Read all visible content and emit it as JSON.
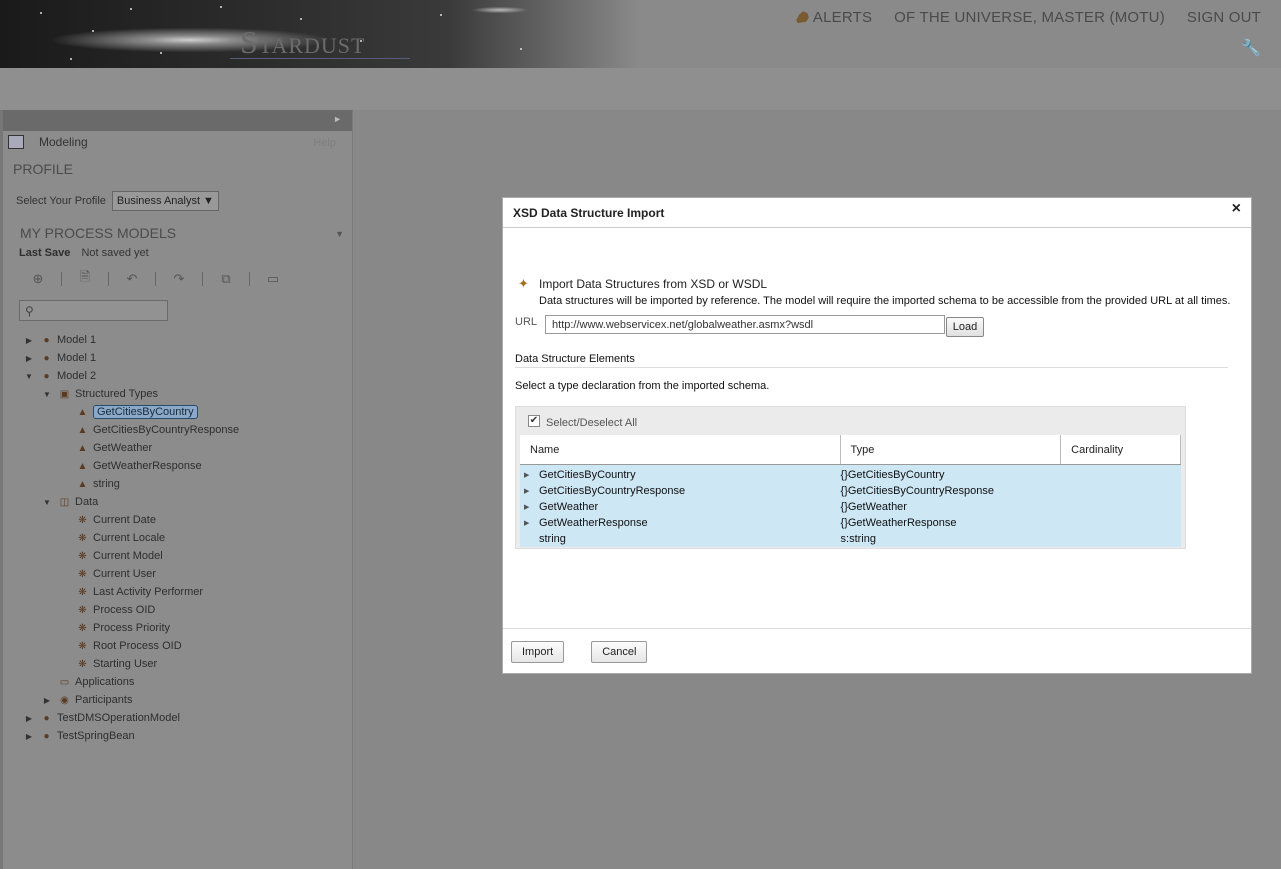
{
  "header": {
    "brand": "Stardust",
    "nav": {
      "alerts": "ALERTS",
      "user": "OF THE UNIVERSE, MASTER (MOTU)",
      "signout": "SIGN OUT"
    },
    "icons": [
      "bell-icon",
      "wrench-icon"
    ]
  },
  "panel": {
    "perspective": "Modeling",
    "help": "Help",
    "profile_heading": "PROFILE",
    "profile_label": "Select Your Profile",
    "profile_value": "Business Analyst",
    "models_heading": "MY PROCESS MODELS",
    "last_save_label": "Last Save",
    "last_save_value": "Not saved yet",
    "search_placeholder": "",
    "tree": [
      {
        "label": "Model 1",
        "level": 0,
        "expander": "collapsed",
        "icon": "model-icon"
      },
      {
        "label": "Model 1",
        "level": 0,
        "expander": "collapsed",
        "icon": "model-icon"
      },
      {
        "label": "Model 2",
        "level": 0,
        "expander": "expanded",
        "icon": "model-icon"
      },
      {
        "label": "Structured Types",
        "level": 1,
        "expander": "expanded",
        "icon": "structured-types-icon"
      },
      {
        "label": "GetCitiesByCountry",
        "level": 2,
        "icon": "type-icon",
        "selected": true
      },
      {
        "label": "GetCitiesByCountryResponse",
        "level": 2,
        "icon": "type-icon"
      },
      {
        "label": "GetWeather",
        "level": 2,
        "icon": "type-icon"
      },
      {
        "label": "GetWeatherResponse",
        "level": 2,
        "icon": "type-icon"
      },
      {
        "label": "string",
        "level": 2,
        "icon": "type-icon"
      },
      {
        "label": "Data",
        "level": 1,
        "expander": "expanded",
        "icon": "database-icon"
      },
      {
        "label": "Current Date",
        "level": 2,
        "icon": "data-icon"
      },
      {
        "label": "Current Locale",
        "level": 2,
        "icon": "data-icon"
      },
      {
        "label": "Current Model",
        "level": 2,
        "icon": "data-icon"
      },
      {
        "label": "Current User",
        "level": 2,
        "icon": "data-icon"
      },
      {
        "label": "Last Activity Performer",
        "level": 2,
        "icon": "data-icon"
      },
      {
        "label": "Process OID",
        "level": 2,
        "icon": "data-icon"
      },
      {
        "label": "Process Priority",
        "level": 2,
        "icon": "data-icon"
      },
      {
        "label": "Root Process OID",
        "level": 2,
        "icon": "data-icon"
      },
      {
        "label": "Starting User",
        "level": 2,
        "icon": "data-icon"
      },
      {
        "label": "Applications",
        "level": 1,
        "icon": "applications-icon"
      },
      {
        "label": "Participants",
        "level": 1,
        "expander": "collapsed",
        "icon": "participants-icon"
      },
      {
        "label": "TestDMSOperationModel",
        "level": 0,
        "expander": "collapsed",
        "icon": "model-icon"
      },
      {
        "label": "TestSpringBean",
        "level": 0,
        "expander": "collapsed",
        "icon": "model-icon"
      }
    ]
  },
  "dialog": {
    "title": "XSD Data Structure Import",
    "import_heading": "Import Data Structures from XSD or WSDL",
    "import_desc": "Data structures will be imported by reference. The model will require the imported schema to be accessible from the provided URL at all times.",
    "url_label": "URL",
    "url_value": "http://www.webservicex.net/globalweather.asmx?wsdl",
    "load_label": "Load",
    "elements_heading": "Data Structure Elements",
    "select_hint": "Select a type declaration from the imported schema.",
    "select_all_label": "Select/Deselect All",
    "columns": [
      "Name",
      "Type",
      "Cardinality"
    ],
    "rows": [
      {
        "name": "GetCitiesByCountry",
        "type": "{}GetCitiesByCountry",
        "cardinality": "",
        "expandable": true
      },
      {
        "name": "GetCitiesByCountryResponse",
        "type": "{}GetCitiesByCountryResponse",
        "cardinality": "",
        "expandable": true
      },
      {
        "name": "GetWeather",
        "type": "{}GetWeather",
        "cardinality": "",
        "expandable": true
      },
      {
        "name": "GetWeatherResponse",
        "type": "{}GetWeatherResponse",
        "cardinality": "",
        "expandable": true
      },
      {
        "name": "string",
        "type": "s:string",
        "cardinality": "",
        "expandable": false
      }
    ],
    "import_button": "Import",
    "cancel_button": "Cancel"
  }
}
